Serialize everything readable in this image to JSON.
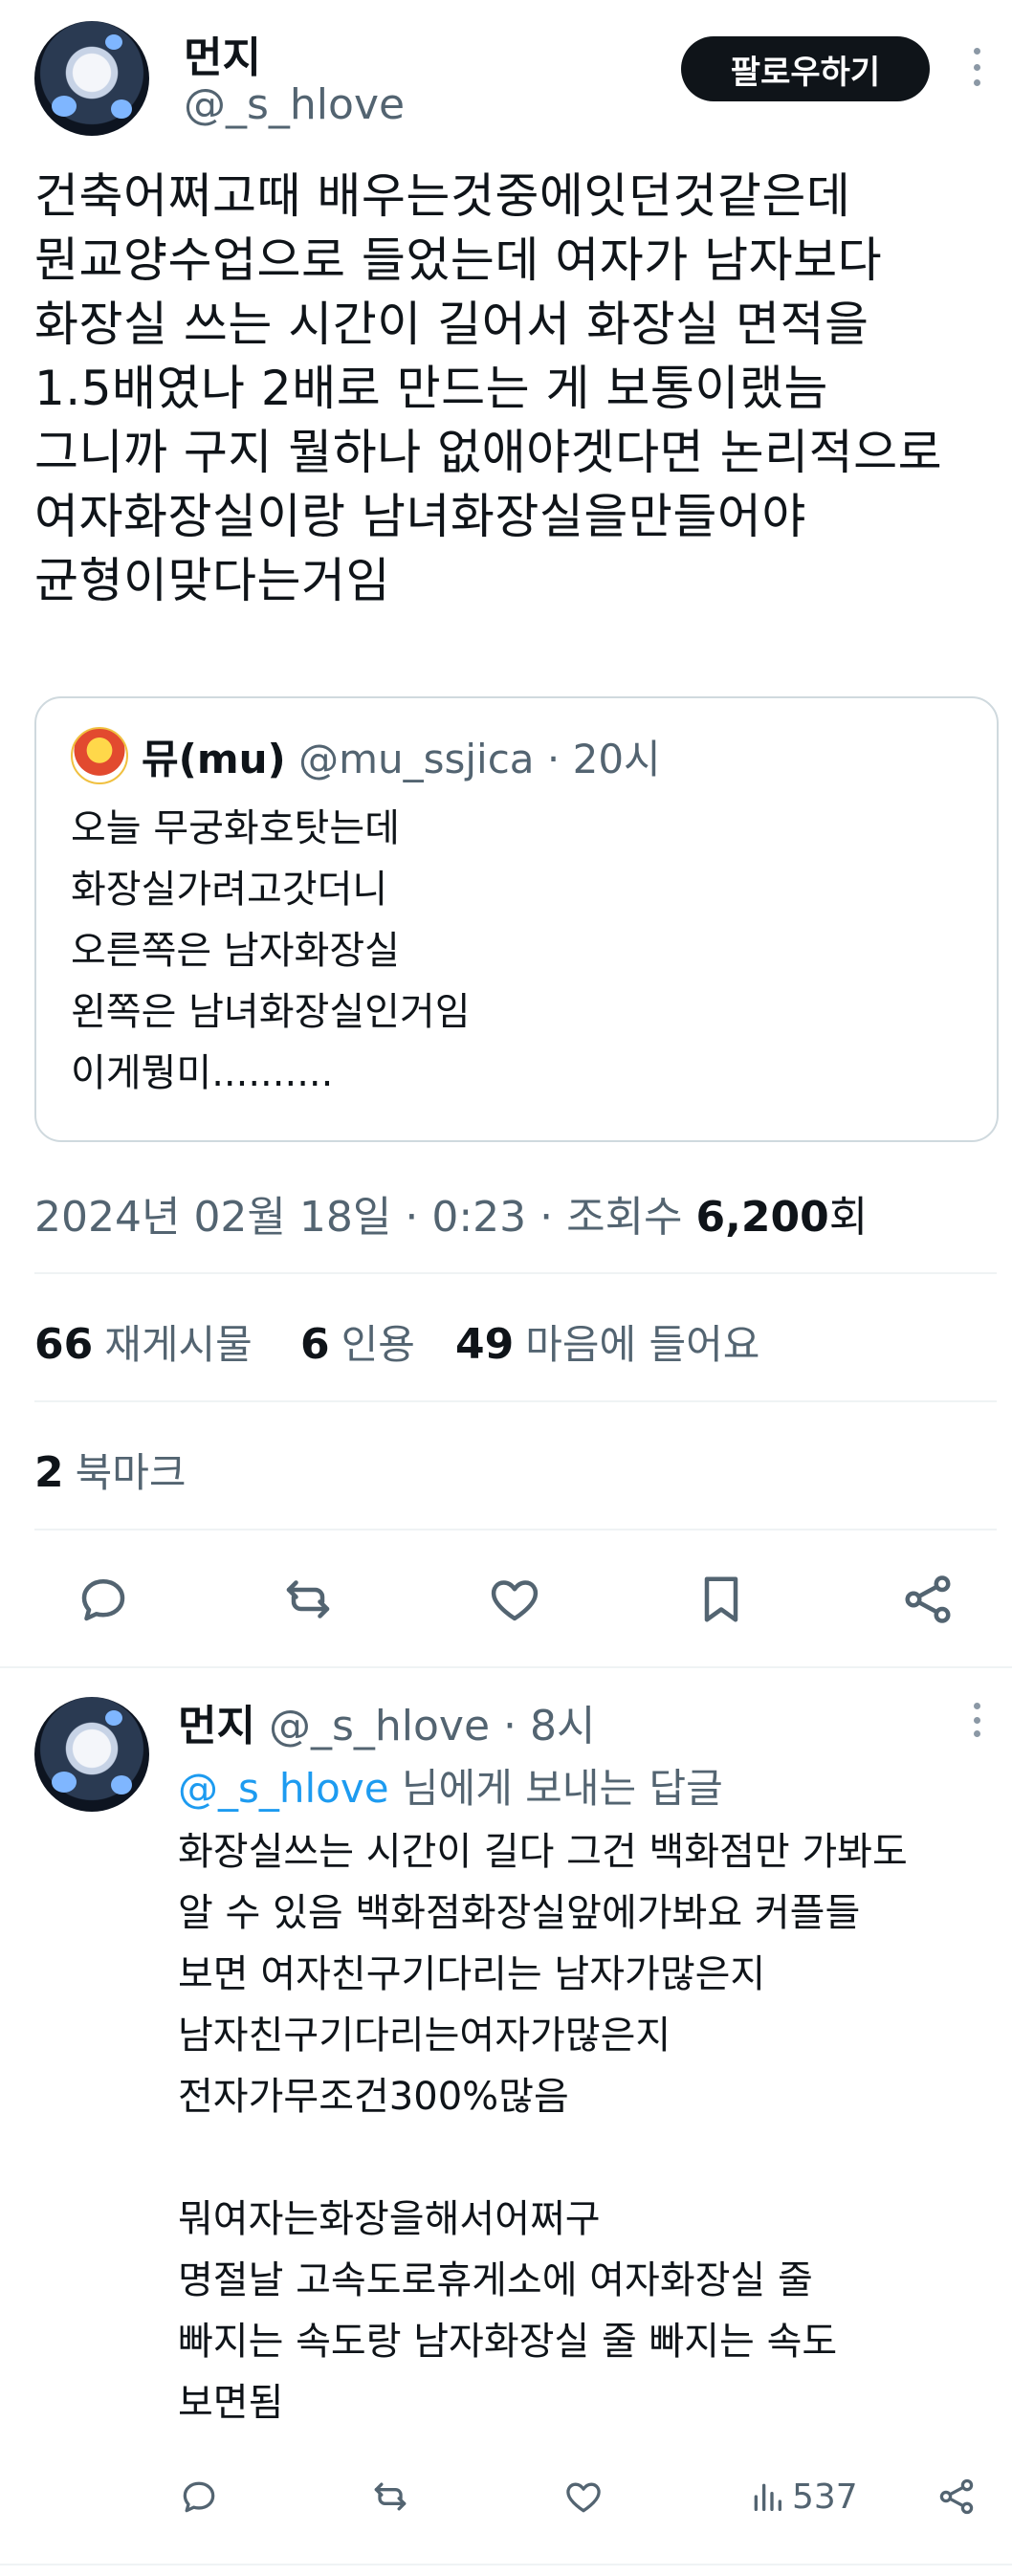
{
  "tweet": {
    "author_name": "먼지",
    "author_handle": "@_s_hlove",
    "follow_label": "팔로우하기",
    "text": "건축어쩌고때 배우는것중에잇던것같은데\n뭔교양수업으로 들었는데 여자가 남자보다\n화장실 쓰는 시간이 길어서 화장실 면적을\n1.5배였나 2배로 만드는 게 보통이랬늠\n그니까 구지 뭘하나 없애야겟다면 논리적으로\n여자화장실이랑 남녀화장실을만들어야\n균형이맞다는거임",
    "quote": {
      "author_name": "뮤(mu)",
      "author_handle": "@mu_ssjica",
      "time": "· 20시",
      "text": "오늘 무궁화호탓는데\n화장실가려고갓더니\n오른쪽은 남자화장실\n왼쪽은 남녀화장실인거임\n이게뭥미.........."
    },
    "meta": {
      "datetime": "2024년 02월 18일 · 0:23 · 조회수",
      "views": "6,200",
      "views_suffix": "회"
    },
    "stats": {
      "retweets_count": "66",
      "retweets_label": "재게시물",
      "quotes_count": "6",
      "quotes_label": "인용",
      "likes_count": "49",
      "likes_label": "마음에 들어요",
      "bookmarks_count": "2",
      "bookmarks_label": "북마크"
    }
  },
  "reply": {
    "author_name": "먼지",
    "author_handle": "@_s_hlove",
    "time": "· 8시",
    "reply_to_handle": "@_s_hlove",
    "reply_to_suffix": " 님에게 보내는 답글",
    "text": "화장실쓰는 시간이 길다 그건 백화점만 가봐도\n알 수 있음 백화점화장실앞에가봐요 커플들\n보면 여자친구기다리는 남자가많은지\n남자친구기다리는여자가많은지\n전자가무조건300%많음\n\n뭐여자는화장을해서어쩌구\n명절날 고속도로휴게소에 여자화장실 줄\n빠지는 속도랑 남자화장실 줄 빠지는 속도\n보면됨",
    "views": "537"
  },
  "icons": {
    "reply": "reply-icon",
    "retweet": "retweet-icon",
    "like": "heart-icon",
    "bookmark": "bookmark-icon",
    "share": "share-icon",
    "views": "bar-chart-icon",
    "more": "more-vertical-icon"
  },
  "colors": {
    "link": "#1d9bf0",
    "secondary_text": "#536471",
    "button_bg": "#0f1419"
  }
}
